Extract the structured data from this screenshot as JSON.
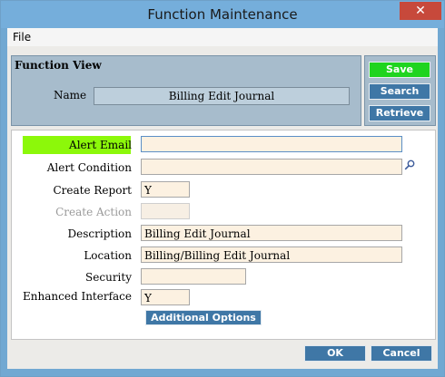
{
  "window": {
    "title": "Function Maintenance",
    "close_symbol": "✕"
  },
  "menu": {
    "items": [
      {
        "label": "File"
      }
    ]
  },
  "function_view": {
    "title": "Function View",
    "name_label": "Name",
    "name_value": "Billing Edit Journal"
  },
  "side_buttons": {
    "save": "Save",
    "search": "Search",
    "retrieve": "Retrieve"
  },
  "form": {
    "fields": [
      {
        "label": "Alert Email",
        "value": "",
        "highlighted": true,
        "focused": true,
        "disabled": false
      },
      {
        "label": "Alert Condition",
        "value": "",
        "highlighted": false,
        "focused": false,
        "disabled": false
      },
      {
        "label": "Create Report",
        "value": "Y",
        "highlighted": false,
        "focused": false,
        "disabled": false
      },
      {
        "label": "Create Action",
        "value": "",
        "highlighted": false,
        "focused": false,
        "disabled": true
      },
      {
        "label": "Description",
        "value": "Billing Edit Journal",
        "highlighted": false,
        "focused": false,
        "disabled": false
      },
      {
        "label": "Location",
        "value": "Billing/Billing Edit Journal",
        "highlighted": false,
        "focused": false,
        "disabled": false
      },
      {
        "label": "Security",
        "value": "",
        "highlighted": false,
        "focused": false,
        "disabled": false
      },
      {
        "label": "Enhanced Interface",
        "value": "Y",
        "highlighted": false,
        "focused": false,
        "disabled": false
      }
    ],
    "lookup_icon": "magnifier-icon",
    "additional_options_label": "Additional Options"
  },
  "footer": {
    "ok_label": "OK",
    "cancel_label": "Cancel"
  },
  "colors": {
    "highlight": "#8cf80a",
    "save_button": "#1fd41f",
    "action_button": "#3f77a6",
    "field_background": "#fcf1e1",
    "panel_background": "#a7bccc"
  }
}
